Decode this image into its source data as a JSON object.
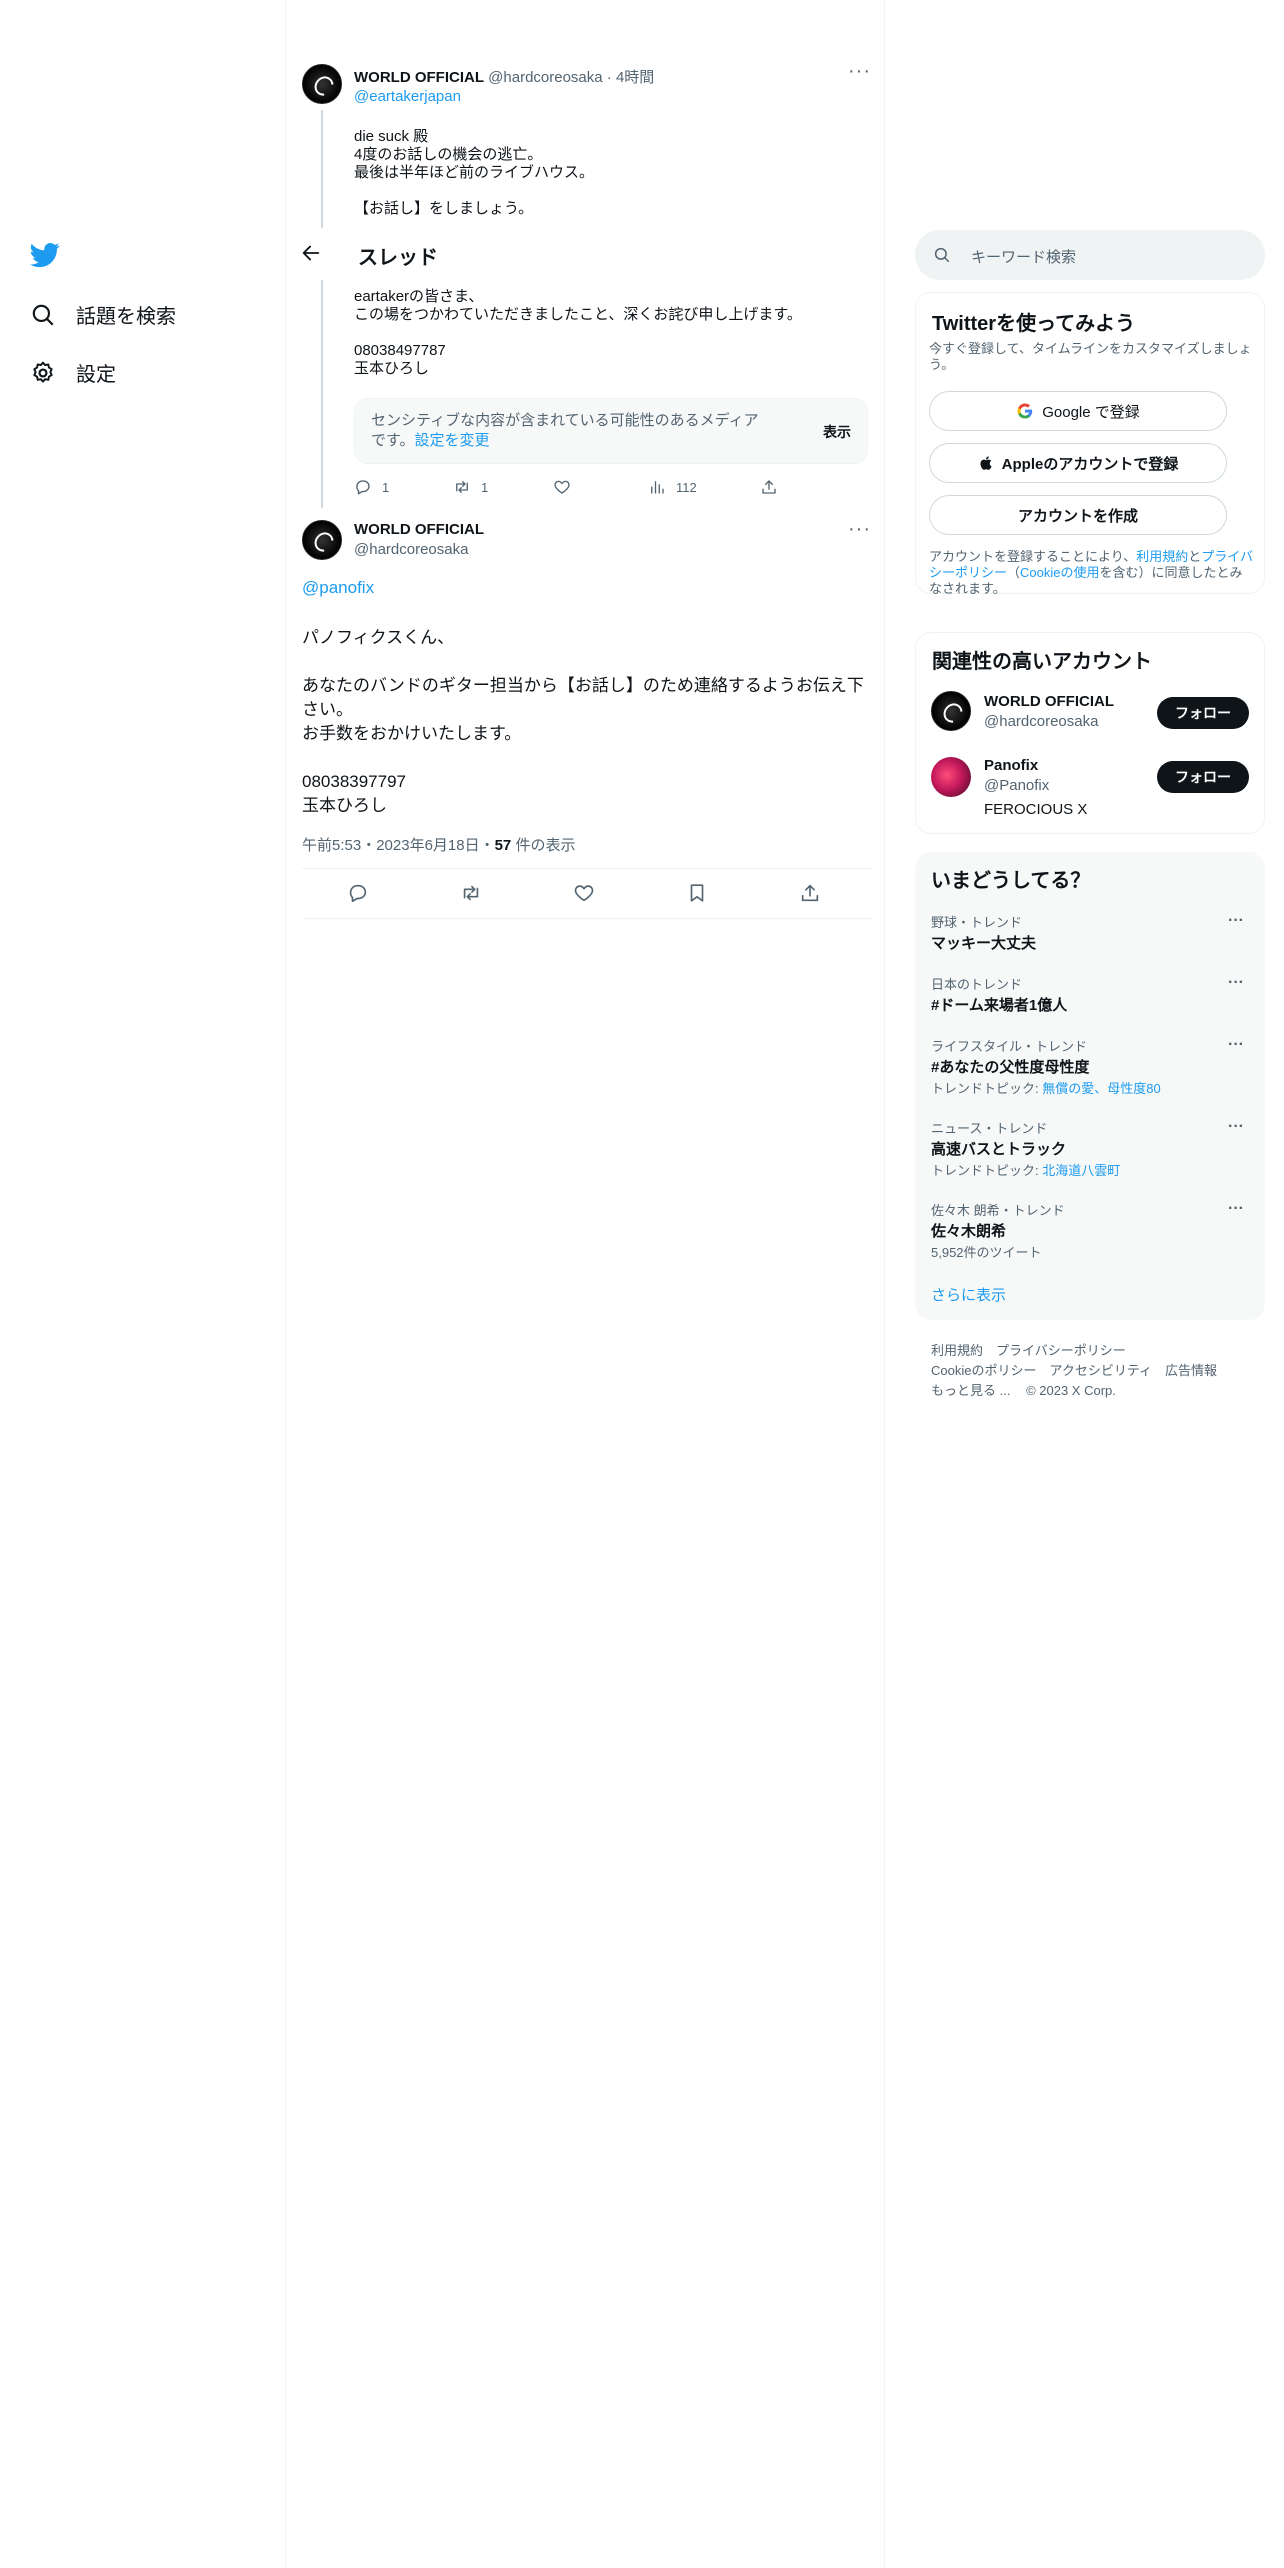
{
  "nav": {
    "explore_label": "話題を検索",
    "settings_label": "設定"
  },
  "header": {
    "title": "スレッド"
  },
  "parent_tweet": {
    "display_name": "WORLD OFFICIAL",
    "handle": "@hardcoreosaka",
    "time": "4時間",
    "reply_to": "@eartakerjapan",
    "text_top": "die suck 殿\n4度のお話しの機会の逃亡。\n最後は半年ほど前のライブハウス。\n\n【お話し】をしましょう。",
    "text_bottom": "eartakerの皆さま、\nこの場をつかわていただきましたこと、深くお詫び申し上げます。\n\n08038497787\n玉本ひろし",
    "sensitive_text": "センシティブな内容が含まれている可能性のあるメディアです。",
    "sensitive_link": "設定を変更",
    "sensitive_show": "表示",
    "reply_count": "1",
    "retweet_count": "1",
    "views_count": "112"
  },
  "main_tweet": {
    "display_name": "WORLD OFFICIAL",
    "handle": "@hardcoreosaka",
    "mention": "@panofix",
    "text": "パノフィクスくん、\n\nあなたのバンドのギター担当から【お話し】のため連絡するようお伝え下\nさい。\nお手数をおかけいたします。\n\n08038397797\n玉本ひろし",
    "timestamp": "午前5:53・2023年6月18日・",
    "views_count": "57",
    "views_label": " 件の表示"
  },
  "search": {
    "placeholder": "キーワード検索"
  },
  "signup": {
    "title": "Twitterを使ってみよう",
    "subtitle": "今すぐ登録して、タイムラインをカスタマイズしましょう。",
    "google_label": "Google で登録",
    "apple_label": "Appleのアカウントで登録",
    "create_label": "アカウントを作成",
    "legal_prefix": "アカウントを登録することにより、",
    "terms_link": "利用規約",
    "legal_and": "と",
    "privacy_link": "プライバシーポリシー",
    "legal_paren_open": "（",
    "cookie_link": "Cookieの使用",
    "legal_suffix": "を含む）に同意したとみなされます。"
  },
  "related": {
    "title": "関連性の高いアカウント",
    "accounts": [
      {
        "name": "WORLD OFFICIAL",
        "handle": "@hardcoreosaka",
        "bio": "",
        "follow": "フォロー"
      },
      {
        "name": "Panofix",
        "handle": "@Panofix",
        "bio": "FEROCIOUS X",
        "follow": "フォロー"
      }
    ]
  },
  "trends": {
    "title": "いまどうしてる？",
    "items": [
      {
        "meta": "野球・トレンド",
        "name": "マッキー大丈夫",
        "sub_label": "",
        "sub_link": ""
      },
      {
        "meta": "日本のトレンド",
        "name": "#ドーム来場者1億人",
        "sub_label": "",
        "sub_link": ""
      },
      {
        "meta": "ライフスタイル・トレンド",
        "name": "#あなたの父性度母性度",
        "sub_label": "トレンドトピック: ",
        "sub_link": "無償の愛、母性度80"
      },
      {
        "meta": "ニュース・トレンド",
        "name": "高速バスとトラック",
        "sub_label": "トレンドトピック: ",
        "sub_link": "北海道八雲町"
      },
      {
        "meta": "佐々木 朗希・トレンド",
        "name": "佐々木朗希",
        "sub_label": "5,952件のツイート",
        "sub_link": ""
      }
    ],
    "show_more": "さらに表示"
  },
  "footer": {
    "line1": "利用規約　プライバシーポリシー",
    "line2": "Cookieのポリシー　アクセシビリティ　広告情報",
    "more": "もっと見る ...",
    "copyright": "© 2023 X Corp."
  },
  "colors": {
    "accent": "#1d9bf0",
    "text": "#0f1419",
    "muted": "#536471",
    "panel": "#f7f9f9"
  }
}
